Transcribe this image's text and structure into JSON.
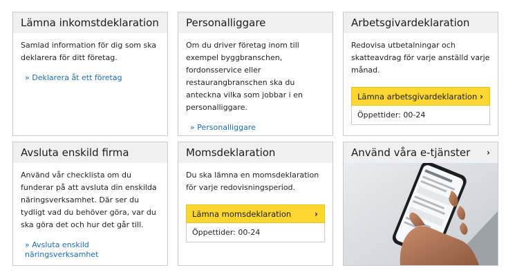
{
  "cards": [
    {
      "title": "Lämna inkomstdeklaration",
      "text": "Samlad information för dig som ska deklarera för ditt företag.",
      "link": "» Deklarera åt ett företag"
    },
    {
      "title": "Personalliggare",
      "text": "Om du driver företag inom till exempel byggbranschen, fordonsservice eller restaurangbranschen ska du anteckna vilka som jobbar i en personalliggare.",
      "link": "» Personalliggare"
    },
    {
      "title": "Arbetsgivardeklaration",
      "text": "Redovisa utbetalningar och skatteavdrag för varje anställd varje månad.",
      "button": "Lämna arbetsgivardeklaration",
      "hours": "Öppettider: 00-24"
    },
    {
      "title": "Avsluta enskild firma",
      "text": "Använd vår checklista om du funderar på att avsluta din enskilda näringsverksamhet. Där ser du tydligt vad du behöver göra, var du ska göra det och hur det går till.",
      "link": "» Avsluta enskild näringsverksamhet"
    },
    {
      "title": "Momsdeklaration",
      "text": "Du ska lämna en momsdeklaration för varje redovisningsperiod.",
      "button": "Lämna momsdeklaration",
      "hours": "Öppettider: 00-24"
    },
    {
      "title": "Använd våra e-tjänster"
    }
  ],
  "icons": {
    "chevron": "›"
  },
  "colors": {
    "button_yellow": "#fdd630",
    "link_blue": "#1a6cb8",
    "header_gray": "#f0f0f0"
  }
}
